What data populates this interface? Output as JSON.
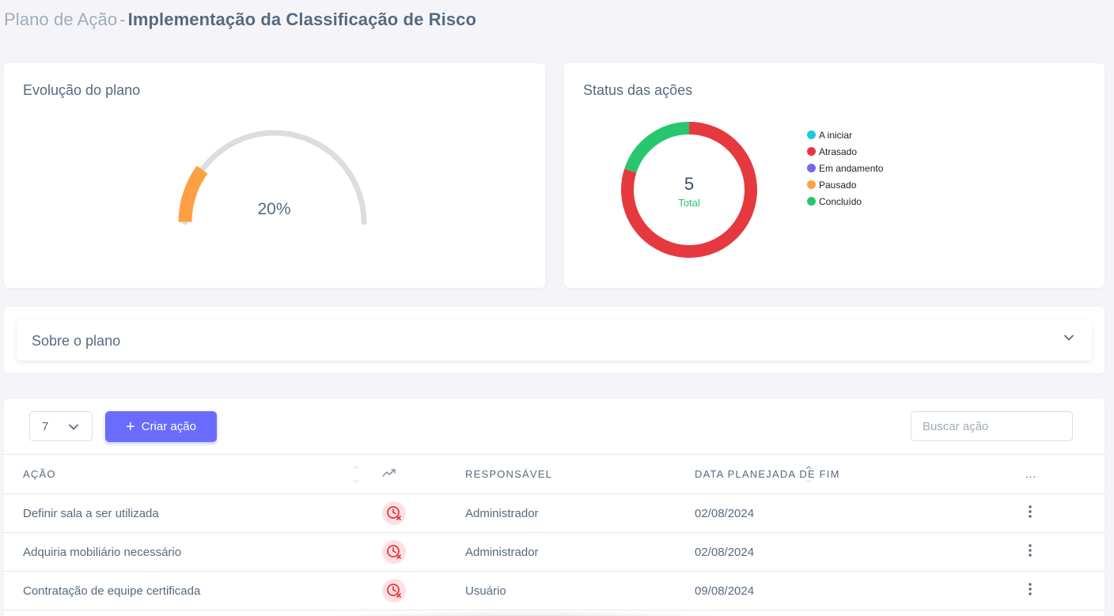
{
  "header": {
    "prefix": "Plano de Ação",
    "separator": "-",
    "title": "Implementação da Classificação de Risco"
  },
  "evolucao": {
    "title": "Evolução do plano",
    "progress": 0.2,
    "progress_label": "20%",
    "colors": {
      "track": "#dcdde1",
      "fill": "#ff9f43"
    }
  },
  "status": {
    "title": "Status das ações",
    "total": "5",
    "total_label": "Total",
    "legend": [
      {
        "label": "A iniciar",
        "color": "#1fc7e4"
      },
      {
        "label": "Atrasado",
        "color": "#e5393f"
      },
      {
        "label": "Em andamento",
        "color": "#7367f0"
      },
      {
        "label": "Pausado",
        "color": "#ff9f43"
      },
      {
        "label": "Concluído",
        "color": "#28c76f"
      }
    ]
  },
  "chart_data": {
    "type": "pie",
    "categories": [
      "A iniciar",
      "Atrasado",
      "Em andamento",
      "Pausado",
      "Concluído"
    ],
    "values": [
      0,
      4,
      0,
      0,
      1
    ],
    "title": "Status das ações",
    "legend": "right"
  },
  "sobre": {
    "title": "Sobre o plano"
  },
  "toolbar": {
    "page_size": "7",
    "create_label": "Criar ação",
    "create_icon": "+",
    "search_placeholder": "Buscar ação"
  },
  "table": {
    "headers": {
      "acao": "Ação",
      "responsavel": "Responsável",
      "data": "Data planejada de fim",
      "menu": "..."
    },
    "rows": [
      {
        "acao": "Definir sala a ser utilizada",
        "responsavel": "Administrador",
        "data": "02/08/2024",
        "status": "atrasado"
      },
      {
        "acao": "Adquiria mobiliário necessário",
        "responsavel": "Administrador",
        "data": "02/08/2024",
        "status": "atrasado"
      },
      {
        "acao": "Contratação de equipe certificada",
        "responsavel": "Usuário",
        "data": "09/08/2024",
        "status": "atrasado"
      }
    ]
  }
}
